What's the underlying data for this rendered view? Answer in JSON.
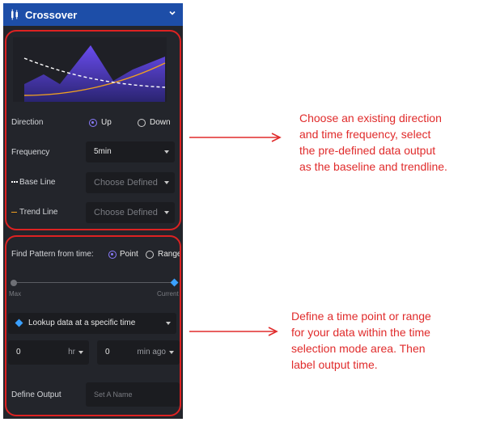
{
  "header": {
    "title": "Crossover",
    "icon": "candlestick-icon"
  },
  "direction": {
    "label": "Direction",
    "options": [
      "Up",
      "Down"
    ],
    "selected": "Up"
  },
  "frequency": {
    "label": "Frequency",
    "value": "5min"
  },
  "base_line": {
    "label": "Base Line",
    "placeholder": "Choose Defined"
  },
  "trend_line": {
    "label": "Trend Line",
    "placeholder": "Choose Defined"
  },
  "pattern": {
    "label": "Find Pattern from time:",
    "options": [
      "Point",
      "Range"
    ],
    "selected": "Point"
  },
  "slider": {
    "left_label": "Max",
    "right_label": "Current",
    "value_fraction": 1.0
  },
  "lookup": {
    "label": "Lookup data at a specific time"
  },
  "time_inputs": {
    "hours_value": "0",
    "hours_unit": "hr",
    "minutes_value": "0",
    "minutes_unit": "min ago"
  },
  "output": {
    "label": "Define Output",
    "placeholder": "Set A Name"
  },
  "annotations": {
    "top": [
      "Choose an existing direction",
      "and time frequency, select",
      "the pre-defined data output",
      "as the baseline and trendline."
    ],
    "bottom": [
      "Define a time point or range",
      "for your data within the time",
      "selection mode area. Then",
      "label output time."
    ]
  },
  "colors": {
    "accent": "#8a7cff",
    "header": "#1d4ea8",
    "panel": "#23252b",
    "annotation": "#e02b2b",
    "trend": "#f0a020",
    "diamond": "#3aa0ff"
  }
}
